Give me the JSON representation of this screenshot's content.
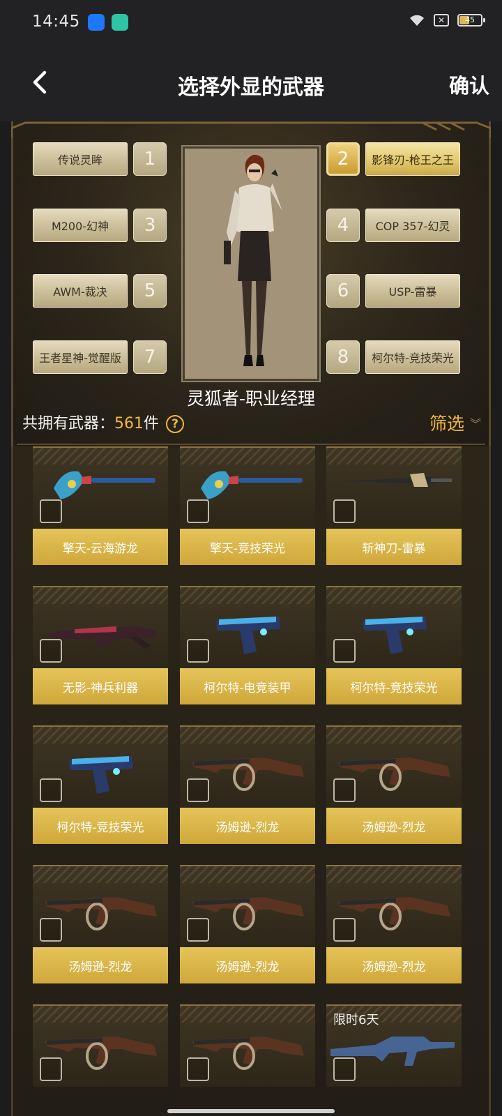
{
  "status_bar": {
    "time": "14:45",
    "battery": "45"
  },
  "header": {
    "title": "选择外显的武器",
    "confirm_label": "确认"
  },
  "loadout": {
    "slots": [
      {
        "num": "1",
        "label": "传说灵眸",
        "active": false
      },
      {
        "num": "2",
        "label": "影锋刃-枪王之王",
        "active": true
      },
      {
        "num": "3",
        "label": "M200-幻神",
        "active": false
      },
      {
        "num": "4",
        "label": "COP 357-幻灵",
        "active": false
      },
      {
        "num": "5",
        "label": "AWM-裁决",
        "active": false
      },
      {
        "num": "6",
        "label": "USP-雷暴",
        "active": false
      },
      {
        "num": "7",
        "label": "王者星神-觉醒版",
        "active": false
      },
      {
        "num": "8",
        "label": "柯尔特-竞技荣光",
        "active": false
      }
    ],
    "character_name": "灵狐者-职业经理"
  },
  "summary": {
    "prefix": "共拥有武器：",
    "count": "561",
    "unit": "件",
    "help": "?",
    "filter_label": "筛选"
  },
  "weapons": [
    {
      "name": "擎天-云海游龙",
      "icon": "axe-icon"
    },
    {
      "name": "擎天-竞技荣光",
      "icon": "axe-icon"
    },
    {
      "name": "斩神刀-雷暴",
      "icon": "sword-icon"
    },
    {
      "name": "无影-神兵利器",
      "icon": "rifle-icon"
    },
    {
      "name": "柯尔特-电竞装甲",
      "icon": "pistol-icon"
    },
    {
      "name": "柯尔特-竞技荣光",
      "icon": "pistol-icon"
    },
    {
      "name": "柯尔特-竞技荣光",
      "icon": "pistol-icon"
    },
    {
      "name": "汤姆逊-烈龙",
      "icon": "smg-icon"
    },
    {
      "name": "汤姆逊-烈龙",
      "icon": "smg-icon"
    },
    {
      "name": "汤姆逊-烈龙",
      "icon": "smg-icon"
    },
    {
      "name": "汤姆逊-烈龙",
      "icon": "smg-icon"
    },
    {
      "name": "汤姆逊-烈龙",
      "icon": "smg-icon"
    },
    {
      "name": "",
      "icon": "smg-icon"
    },
    {
      "name": "",
      "icon": "smg-icon"
    },
    {
      "name": "",
      "icon": "assault-rifle-silhouette-icon",
      "badge": "限时6天"
    }
  ],
  "colors": {
    "accent": "#f1b740",
    "card_label": "#d9b548",
    "background": "#1c1c1d"
  }
}
